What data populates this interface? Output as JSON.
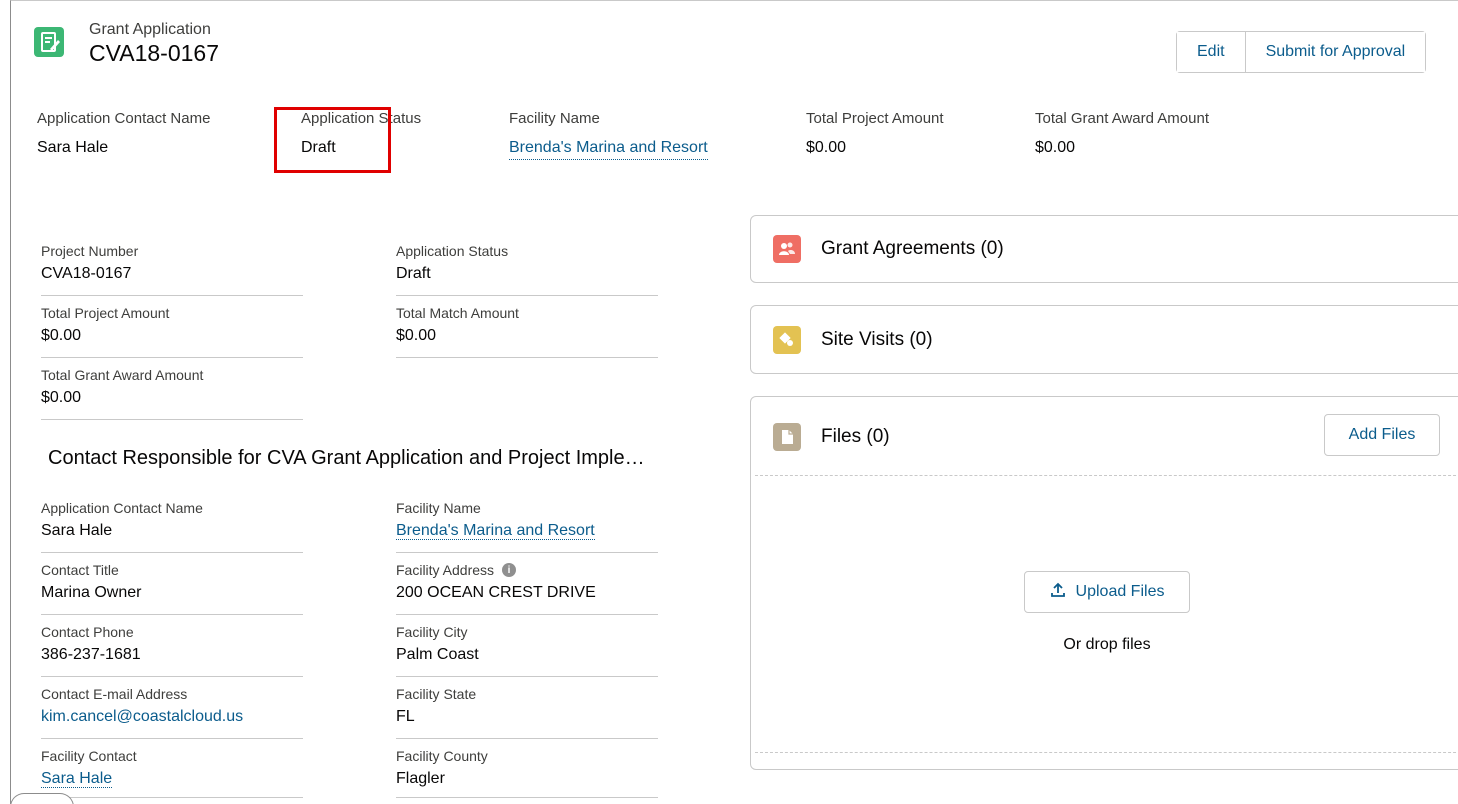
{
  "header": {
    "object_type": "Grant Application",
    "record_name": "CVA18-0167",
    "actions": {
      "edit": "Edit",
      "submit": "Submit for Approval"
    }
  },
  "highlights": [
    {
      "label": "Application Contact Name",
      "value": "Sara Hale"
    },
    {
      "label": "Application Status",
      "value": "Draft"
    },
    {
      "label": "Facility Name",
      "value": "Brenda's Marina and Resort"
    },
    {
      "label": "Total Project Amount",
      "value": "$0.00"
    },
    {
      "label": "Total Grant Award Amount",
      "value": "$0.00"
    }
  ],
  "details": {
    "project_number": {
      "label": "Project Number",
      "value": "CVA18-0167"
    },
    "application_status": {
      "label": "Application Status",
      "value": "Draft"
    },
    "total_project_amount": {
      "label": "Total Project Amount",
      "value": "$0.00"
    },
    "total_match_amount": {
      "label": "Total Match Amount",
      "value": "$0.00"
    },
    "total_grant_award_amount": {
      "label": "Total Grant Award Amount",
      "value": "$0.00"
    }
  },
  "contact_section": {
    "title": "Contact Responsible for CVA Grant Application and Project Imple…",
    "application_contact_name": {
      "label": "Application Contact Name",
      "value": "Sara Hale"
    },
    "facility_name": {
      "label": "Facility Name",
      "value": "Brenda's Marina and Resort"
    },
    "contact_title": {
      "label": "Contact Title",
      "value": "Marina Owner"
    },
    "facility_address": {
      "label": "Facility Address",
      "value": "200 OCEAN CREST DRIVE"
    },
    "contact_phone": {
      "label": "Contact Phone",
      "value": "386-237-1681"
    },
    "facility_city": {
      "label": "Facility City",
      "value": "Palm Coast"
    },
    "contact_email": {
      "label": "Contact E-mail Address",
      "value": "kim.cancel@coastalcloud.us"
    },
    "facility_state": {
      "label": "Facility State",
      "value": "FL"
    },
    "facility_contact": {
      "label": "Facility Contact",
      "value": "Sara Hale"
    },
    "facility_county": {
      "label": "Facility County",
      "value": "Flagler"
    }
  },
  "related": {
    "grant_agreements": "Grant Agreements (0)",
    "site_visits": "Site Visits (0)",
    "files": "Files (0)",
    "add_files": "Add Files",
    "upload_files": "Upload Files",
    "drop_text": "Or drop files"
  },
  "colors": {
    "record_icon": "#3cb774",
    "grant_agreements_icon": "#ef6e64",
    "site_visits_icon": "#e3c252",
    "files_icon": "#baac93",
    "link": "#0b5c8c",
    "highlight_box": "#e00000"
  },
  "icons": {
    "record": "document-edit-icon",
    "grant_agreements": "people-icon",
    "site_visits": "location-tag-icon",
    "files": "file-icon",
    "info": "info-icon",
    "upload": "upload-icon"
  }
}
